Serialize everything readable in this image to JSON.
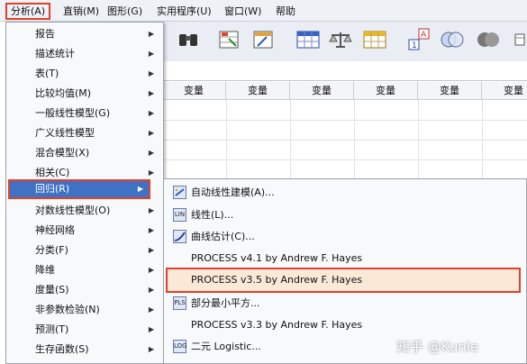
{
  "menubar": {
    "items": [
      {
        "label": "分析(A)",
        "active": true
      },
      {
        "label": "直销(M)"
      },
      {
        "label": "图形(G)"
      },
      {
        "label": "实用程序(U)"
      },
      {
        "label": "窗口(W)"
      },
      {
        "label": "帮助"
      }
    ]
  },
  "toolbar": {
    "icons": [
      "binoculars-icon",
      "goto-case-icon",
      "goto-variable-icon",
      "variables-icon",
      "weight-scale-icon",
      "split-file-icon",
      "value-labels-icon",
      "venn-icon",
      "sets-icon"
    ]
  },
  "grid": {
    "column_header": "变量",
    "columns": [
      "变量",
      "变量",
      "变量",
      "变量",
      "变量",
      "变量"
    ]
  },
  "analyze_menu": {
    "items": [
      {
        "label": "报告",
        "submenu": true
      },
      {
        "label": "描述统计",
        "submenu": true
      },
      {
        "label": "表(T)",
        "submenu": true
      },
      {
        "label": "比较均值(M)",
        "submenu": true
      },
      {
        "label": "一般线性模型(G)",
        "submenu": true
      },
      {
        "label": "广义线性模型",
        "submenu": true
      },
      {
        "label": "混合模型(X)",
        "submenu": true
      },
      {
        "label": "相关(C)",
        "submenu": true
      },
      {
        "label": "回归(R)",
        "submenu": true,
        "highlighted": true
      },
      {
        "label": "对数线性模型(O)",
        "submenu": true
      },
      {
        "label": "神经网络",
        "submenu": true
      },
      {
        "label": "分类(F)",
        "submenu": true
      },
      {
        "label": "降维",
        "submenu": true
      },
      {
        "label": "度量(S)",
        "submenu": true
      },
      {
        "label": "非参数检验(N)",
        "submenu": true
      },
      {
        "label": "预测(T)",
        "submenu": true
      },
      {
        "label": "生存函数(S)",
        "submenu": true
      }
    ]
  },
  "regression_submenu": {
    "items": [
      {
        "label": "自动线性建模(A)...",
        "icon": "auto-linear-icon",
        "icon_text": ""
      },
      {
        "label": "线性(L)...",
        "icon": "linear-regression-icon",
        "icon_text": "LIN"
      },
      {
        "label": "曲线估计(C)...",
        "icon": "curve-estimation-icon",
        "icon_text": ""
      },
      {
        "label": "PROCESS v4.1 by Andrew F. Hayes",
        "icon": null
      },
      {
        "label": "PROCESS v3.5 by Andrew F. Hayes",
        "icon": null,
        "boxed": true
      },
      {
        "label": "部分最小平方...",
        "icon": "partial-least-squares-icon",
        "icon_text": "PLS"
      },
      {
        "label": "PROCESS v3.3 by Andrew F. Hayes",
        "icon": null
      },
      {
        "label": "二元 Logistic...",
        "icon": "binary-logistic-icon",
        "icon_text": "LOG"
      }
    ]
  },
  "watermark": "知乎 @Kunle",
  "colors": {
    "highlight": "#3f71c4",
    "annotation_red": "#e2402a"
  }
}
